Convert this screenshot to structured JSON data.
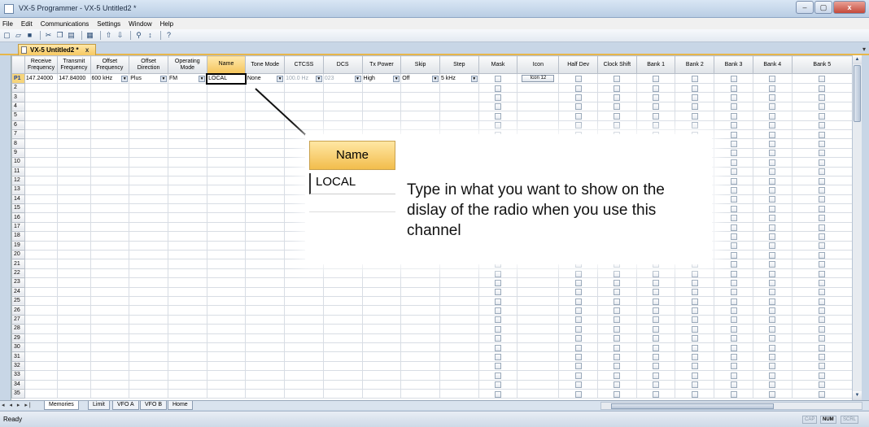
{
  "window": {
    "title": "VX-5 Programmer - VX-5 Untitled2 *",
    "buttons": [
      "–",
      "▢",
      "x"
    ]
  },
  "menu": [
    "File",
    "Edit",
    "Communications",
    "Settings",
    "Window",
    "Help"
  ],
  "toolbar_icons": [
    "new-icon",
    "open-icon",
    "save-icon",
    "cut-icon",
    "copy-icon",
    "paste-icon",
    "print-icon",
    "upload-icon",
    "download-icon",
    "find-icon",
    "sort-icon",
    "help-icon"
  ],
  "doc_tab": {
    "label": "VX-5 Untitled2 *",
    "close": "x"
  },
  "grid": {
    "headers": [
      "",
      "Receive Frequency",
      "Transmit Frequency",
      "Offset Frequency",
      "Offset Direction",
      "Operating Mode",
      "Name",
      "Tone Mode",
      "CTCSS",
      "DCS",
      "Tx Power",
      "Skip",
      "Step",
      "Mask",
      "Icon",
      "Half Dev",
      "Clock Shift",
      "Bank 1",
      "Bank 2",
      "Bank 3",
      "Bank 4",
      "Bank 5"
    ],
    "row1": {
      "num": "P1",
      "receive": "147.24000",
      "transmit": "147.84000",
      "offset": "600 kHz",
      "direction": "Plus",
      "mode": "FM",
      "name": "LOCAL",
      "tone_mode": "None",
      "ctcss": "100.0 Hz",
      "dcs": "023",
      "tx_power": "High",
      "skip": "Off",
      "step": "5 kHz",
      "icon": "Icon 12"
    },
    "row_numbers": [
      "2",
      "3",
      "4",
      "5",
      "6",
      "7",
      "8",
      "9",
      "10",
      "11",
      "12",
      "13",
      "14",
      "15",
      "16",
      "17",
      "18",
      "19",
      "20",
      "21",
      "22",
      "23",
      "24",
      "25",
      "26",
      "27",
      "28",
      "29",
      "30",
      "31",
      "32",
      "33",
      "34",
      "35"
    ]
  },
  "sheet_nav": "◂ ◂ ▸ ▸|",
  "sheet_tabs": [
    "Memories",
    "Limit",
    "VFO A",
    "VFO B",
    "Home"
  ],
  "status": {
    "text": "Ready",
    "indicators": [
      "CAP",
      "NUM",
      "SCRL"
    ]
  },
  "callout": {
    "header": "Name",
    "value": "LOCAL",
    "text": "Type in what you want to show on the dislay of the radio when you use this channel"
  }
}
